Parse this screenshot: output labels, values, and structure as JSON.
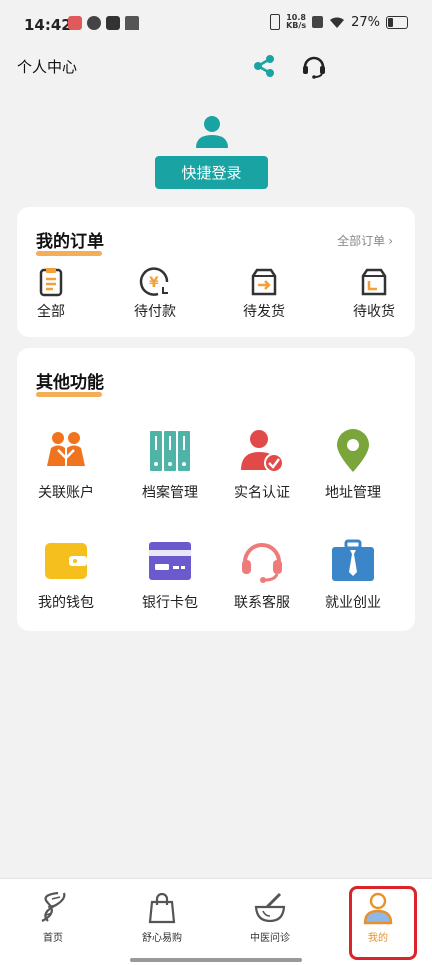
{
  "status_bar": {
    "time": "14:42",
    "speed_value": "10.8",
    "speed_unit": "KB/s",
    "battery": "27%"
  },
  "header": {
    "title": "个人中心",
    "share_icon": "share-icon",
    "service_icon": "headset-icon"
  },
  "profile": {
    "login_label": "快捷登录"
  },
  "orders": {
    "title": "我的订单",
    "all_link": "全部订单",
    "items": [
      {
        "label": "全部",
        "icon": "clipboard-icon"
      },
      {
        "label": "待付款",
        "icon": "yen-clock-icon"
      },
      {
        "label": "待发货",
        "icon": "box-send-icon"
      },
      {
        "label": "待收货",
        "icon": "box-receive-icon"
      }
    ]
  },
  "functions": {
    "title": "其他功能",
    "items": [
      {
        "label": "关联账户",
        "icon": "linked-users-icon"
      },
      {
        "label": "档案管理",
        "icon": "archive-icon"
      },
      {
        "label": "实名认证",
        "icon": "verified-user-icon"
      },
      {
        "label": "地址管理",
        "icon": "location-pin-icon"
      },
      {
        "label": "我的钱包",
        "icon": "wallet-icon"
      },
      {
        "label": "银行卡包",
        "icon": "bank-card-icon"
      },
      {
        "label": "联系客服",
        "icon": "headset-icon"
      },
      {
        "label": "就业创业",
        "icon": "briefcase-icon"
      }
    ]
  },
  "bottom_nav": {
    "items": [
      {
        "label": "首页",
        "icon": "dna-icon"
      },
      {
        "label": "舒心易购",
        "icon": "shopping-bag-icon"
      },
      {
        "label": "中医问诊",
        "icon": "mortar-icon"
      },
      {
        "label": "我的",
        "icon": "person-icon"
      }
    ]
  },
  "colors": {
    "accent": "#1aa3a3",
    "highlight": "#f3a03b",
    "active_nav": "#e8912a",
    "frame": "#d9252a"
  }
}
